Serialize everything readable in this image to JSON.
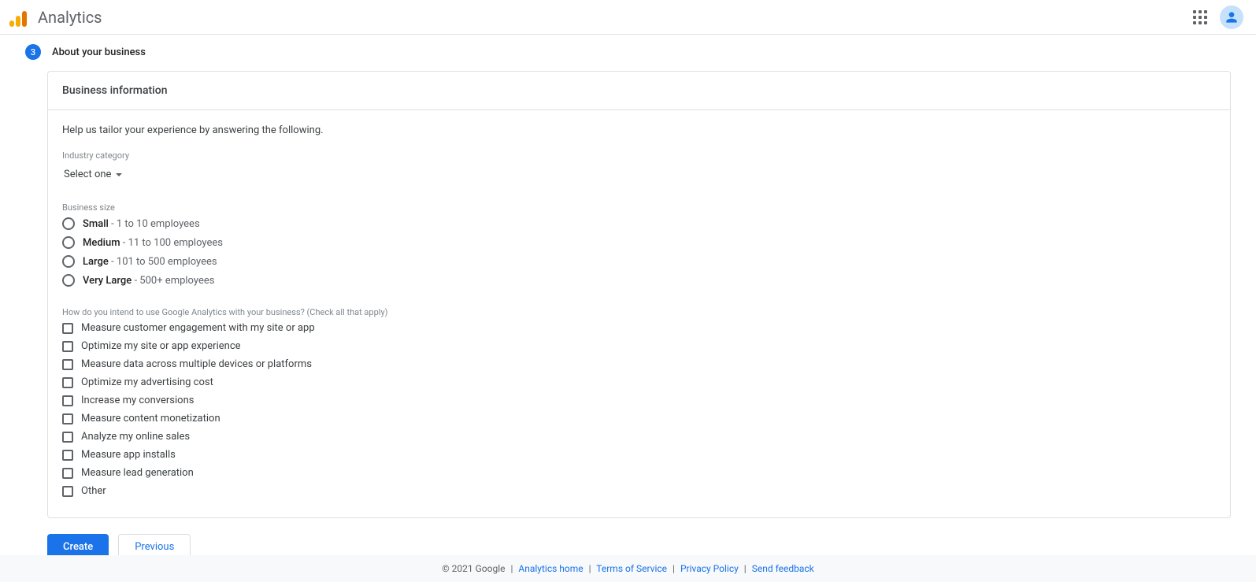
{
  "header": {
    "title": "Analytics"
  },
  "step": {
    "number": "3",
    "title": "About your business"
  },
  "card": {
    "title": "Business information",
    "intro": "Help us tailor your experience by answering the following.",
    "industry": {
      "label": "Industry category",
      "selected": "Select one"
    },
    "businessSize": {
      "label": "Business size",
      "options": [
        {
          "main": "Small",
          "sub": " - 1 to 10 employees"
        },
        {
          "main": "Medium",
          "sub": " - 11 to 100 employees"
        },
        {
          "main": "Large",
          "sub": " - 101 to 500 employees"
        },
        {
          "main": "Very Large",
          "sub": " - 500+ employees"
        }
      ]
    },
    "usage": {
      "label": "How do you intend to use Google Analytics with your business? (Check all that apply)",
      "options": [
        "Measure customer engagement with my site or app",
        "Optimize my site or app experience",
        "Measure data across multiple devices or platforms",
        "Optimize my advertising cost",
        "Increase my conversions",
        "Measure content monetization",
        "Analyze my online sales",
        "Measure app installs",
        "Measure lead generation",
        "Other"
      ]
    }
  },
  "buttons": {
    "create": "Create",
    "previous": "Previous"
  },
  "footer": {
    "copyright": "© 2021 Google",
    "links": {
      "home": "Analytics home",
      "tos": "Terms of Service",
      "privacy": "Privacy Policy",
      "feedback": "Send feedback"
    }
  }
}
